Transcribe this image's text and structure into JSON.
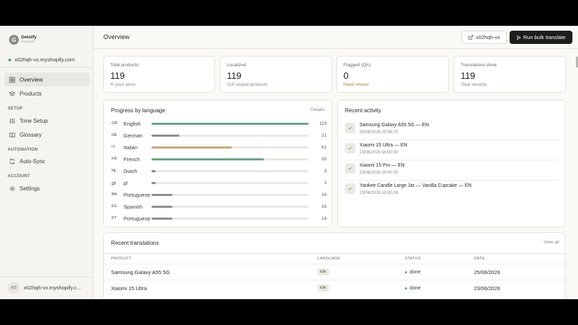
{
  "brand": {
    "name": "Getoify",
    "sub": "TRANSLATE",
    "initial": "G"
  },
  "shop": "x02hqh-vx.myshopify.com",
  "nav": {
    "overview": "Overview",
    "products": "Products",
    "setup_label": "SETUP",
    "tone_setup": "Tone Setup",
    "glossary": "Glossary",
    "automation_label": "AUTOMATION",
    "auto_sync": "Auto-Sync",
    "account_label": "ACCOUNT",
    "settings": "Settings"
  },
  "user": {
    "initials": "XO",
    "name": "x02hqh-vx.myshopify.c..."
  },
  "header": {
    "title": "Overview",
    "store_button": "x02hqh-vx",
    "bulk_button": "Run bulk translate"
  },
  "stats": [
    {
      "label": "Total products",
      "value": "119",
      "sub": "In your store"
    },
    {
      "label": "Localized",
      "value": "119",
      "sub": "119 unique products"
    },
    {
      "label": "Flagged (QA)",
      "value": "0",
      "sub": "Need review"
    },
    {
      "label": "Translations done",
      "value": "119",
      "sub": "Total records"
    }
  ],
  "progress": {
    "title": "Progress by language",
    "details": "Details",
    "max": 119,
    "languages": [
      {
        "code": "GB",
        "name": "English",
        "count": 119,
        "color": "#6aa588"
      },
      {
        "code": "DE",
        "name": "German",
        "count": 21,
        "color": "#8f8d87"
      },
      {
        "code": "IT",
        "name": "Italian",
        "count": 61,
        "color": "#c9a877"
      },
      {
        "code": "FR",
        "name": "French",
        "count": 85,
        "color": "#6aa588"
      },
      {
        "code": "NL",
        "name": "Dutch",
        "count": 3,
        "color": "#8f8d87"
      },
      {
        "code": "pl",
        "name": "pl",
        "count": 3,
        "color": "#8f8d87"
      },
      {
        "code": "BR",
        "name": "Portuguese",
        "count": 16,
        "color": "#8f8d87"
      },
      {
        "code": "ES",
        "name": "Spanish",
        "count": 16,
        "color": "#8f8d87"
      },
      {
        "code": "PT",
        "name": "Portuguese",
        "count": 16,
        "color": "#8f8d87"
      }
    ]
  },
  "activity": {
    "title": "Recent activity",
    "items": [
      {
        "title": "Samsung Galaxy A55 5G — EN",
        "time": "25/06/2026 15:58:23"
      },
      {
        "title": "Xiaomi 15 Ultra — EN",
        "time": "23/06/2026 16:00:30"
      },
      {
        "title": "Xiaomi 15 Pro — EN",
        "time": "23/06/2026 16:00:30"
      },
      {
        "title": "Yankee Candle Large Jar — Vanilla Cupcake — EN",
        "time": "23/06/2026 16:00:29"
      }
    ]
  },
  "recent": {
    "title": "Recent translations",
    "view_all": "View all",
    "columns": [
      "PRODUCT",
      "LANGUAGE",
      "STATUS",
      "DATE"
    ],
    "rows": [
      {
        "product": "Samsung Galaxy A55 5G",
        "language": "EN",
        "status": "done",
        "date": "25/06/2026"
      },
      {
        "product": "Xiaomi 15 Ultra",
        "language": "EN",
        "status": "done",
        "date": "23/06/2026"
      }
    ]
  }
}
